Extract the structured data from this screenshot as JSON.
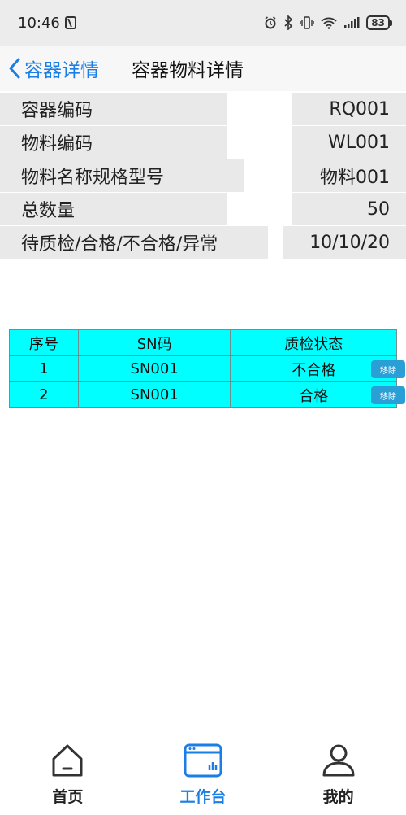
{
  "status_bar": {
    "time": "10:46",
    "battery": "83"
  },
  "nav": {
    "back_label": "容器详情",
    "title": "容器物料详情"
  },
  "details": [
    {
      "label": "容器编码",
      "value": "RQ001"
    },
    {
      "label": "物料编码",
      "value": "WL001"
    },
    {
      "label": "物料名称规格型号",
      "value": "物料001"
    },
    {
      "label": "总数量",
      "value": "50"
    },
    {
      "label": "待质检/合格/不合格/异常",
      "value": "10/10/20"
    }
  ],
  "table": {
    "headers": [
      "序号",
      "SN码",
      "质检状态"
    ],
    "rows": [
      {
        "index": "1",
        "sn": "SN001",
        "status": "不合格",
        "action": "移除"
      },
      {
        "index": "2",
        "sn": "SN001",
        "status": "合格",
        "action": "移除"
      }
    ]
  },
  "tabs": [
    {
      "label": "首页",
      "icon": "home-icon",
      "active": false
    },
    {
      "label": "工作台",
      "icon": "workbench-icon",
      "active": true
    },
    {
      "label": "我的",
      "icon": "user-icon",
      "active": false
    }
  ],
  "colors": {
    "accent": "#1a7ee6",
    "table_bg": "#00ffff",
    "remove_button": "#2a9fd6"
  }
}
